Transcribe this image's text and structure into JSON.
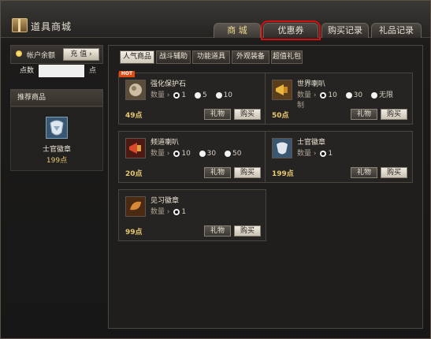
{
  "window": {
    "title": "道具商城"
  },
  "tabs": [
    {
      "label": "商 城",
      "active": true
    },
    {
      "label": "优惠券",
      "highlighted": true
    },
    {
      "label": "购买记录"
    },
    {
      "label": "礼品记录"
    }
  ],
  "balance": {
    "label": "帐户余额",
    "recharge_label": "充 值 ›",
    "points_label": "点数",
    "points_value": "",
    "points_unit": "点"
  },
  "recommended": {
    "title": "推荐商品",
    "item_name": "士官徽章",
    "item_price": "199点"
  },
  "categories": [
    {
      "label": "人气商品",
      "active": true
    },
    {
      "label": "战斗辅助"
    },
    {
      "label": "功能道具"
    },
    {
      "label": "外观装备"
    },
    {
      "label": "超值礼包"
    }
  ],
  "hot_badge": "HOT",
  "items": [
    {
      "name": "强化保护石",
      "qty_label": "数量",
      "options": [
        "1",
        "5",
        "10"
      ],
      "selected": 0,
      "price": "49点",
      "gift_label": "礼物",
      "buy_label": "购买",
      "icon": "stone-icon",
      "color": "#b8a58a"
    },
    {
      "name": "世界喇叭",
      "qty_label": "数量",
      "options": [
        "10",
        "30",
        "无限"
      ],
      "selected": 0,
      "qty_suffix": "制",
      "price": "50点",
      "gift_label": "礼物",
      "buy_label": "购买",
      "icon": "megaphone-icon",
      "color": "#d8a030"
    },
    {
      "name": "频道喇叭",
      "qty_label": "数量",
      "options": [
        "10",
        "30",
        "50"
      ],
      "selected": 0,
      "price": "20点",
      "gift_label": "礼物",
      "buy_label": "购买",
      "icon": "red-megaphone-icon",
      "color": "#c83820"
    },
    {
      "name": "士官徽章",
      "qty_label": "数量",
      "options": [
        "1"
      ],
      "selected": 0,
      "price": "199点",
      "gift_label": "礼物",
      "buy_label": "购买",
      "icon": "badge-icon",
      "color": "#7aa0c0"
    },
    {
      "name": "见习徽章",
      "qty_label": "数量",
      "options": [
        "1"
      ],
      "selected": 0,
      "price": "99点",
      "gift_label": "礼物",
      "buy_label": "购买",
      "icon": "trainee-badge-icon",
      "color": "#c07a30"
    }
  ]
}
